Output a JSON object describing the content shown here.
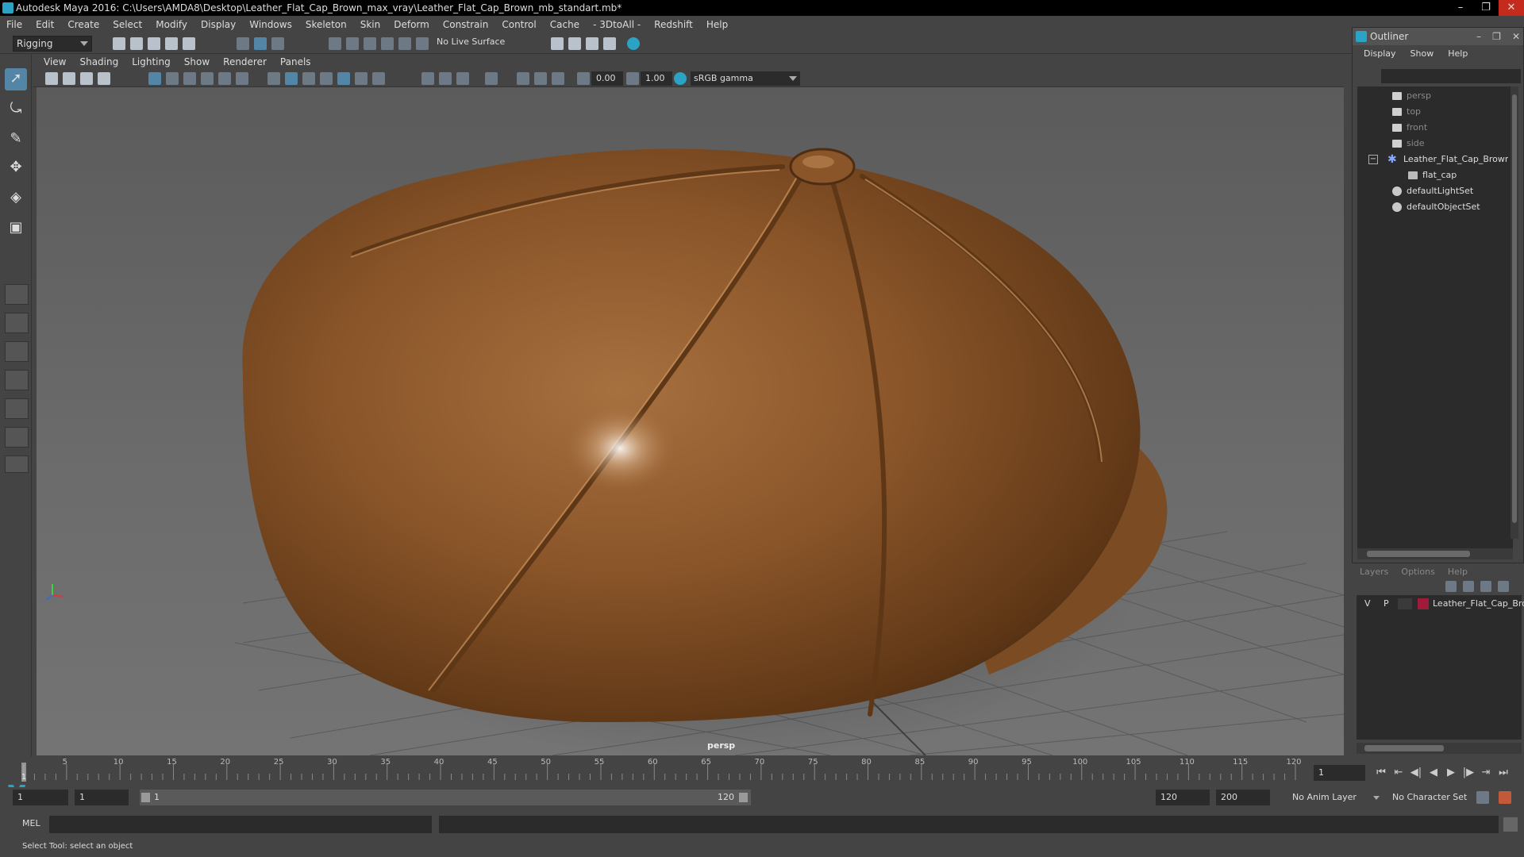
{
  "window": {
    "title": "Autodesk Maya 2016: C:\\Users\\AMDA8\\Desktop\\Leather_Flat_Cap_Brown_max_vray\\Leather_Flat_Cap_Brown_mb_standart.mb*",
    "controls": [
      "–",
      "❐",
      "✕"
    ]
  },
  "menubar": [
    "File",
    "Edit",
    "Create",
    "Select",
    "Modify",
    "Display",
    "Windows",
    "Skeleton",
    "Skin",
    "Deform",
    "Constrain",
    "Control",
    "Cache",
    "- 3DtoAll -",
    "Redshift",
    "Help"
  ],
  "statusline": {
    "mode": "Rigging",
    "live_surface": "No Live Surface"
  },
  "panel": {
    "menus": [
      "View",
      "Shading",
      "Lighting",
      "Show",
      "Renderer",
      "Panels"
    ],
    "exposure": "0.00",
    "gamma_value": "1.00",
    "color_space": "sRGB gamma",
    "camera_label": "persp"
  },
  "outliner": {
    "title": "Outliner",
    "menus": [
      "Display",
      "Show",
      "Help"
    ],
    "items": [
      {
        "label": "persp",
        "kind": "camera",
        "dim": true
      },
      {
        "label": "top",
        "kind": "camera",
        "dim": true
      },
      {
        "label": "front",
        "kind": "camera",
        "dim": true
      },
      {
        "label": "side",
        "kind": "camera",
        "dim": true
      },
      {
        "label": "Leather_Flat_Cap_Brown",
        "kind": "group",
        "dim": false
      },
      {
        "label": "flat_cap",
        "kind": "mesh",
        "dim": false
      },
      {
        "label": "defaultLightSet",
        "kind": "set",
        "dim": false
      },
      {
        "label": "defaultObjectSet",
        "kind": "set",
        "dim": false
      }
    ],
    "expand_glyph": "−"
  },
  "layers": {
    "menus": [
      "Layers",
      "Options",
      "Help"
    ],
    "row": {
      "visible": "V",
      "playback": "P",
      "name": "Leather_Flat_Cap_Brov",
      "color": "#9e1b3a"
    }
  },
  "timeline": {
    "start": 1,
    "end": 120,
    "ticks": [
      "1",
      "5",
      "10",
      "15",
      "20",
      "25",
      "30",
      "35",
      "40",
      "45",
      "50",
      "55",
      "60",
      "65",
      "70",
      "75",
      "80",
      "85",
      "90",
      "95",
      "100",
      "105",
      "110",
      "115",
      "120"
    ],
    "current_frame": "1"
  },
  "range": {
    "start_field": "1",
    "current_field": "1",
    "slider_start": "1",
    "slider_end": "120",
    "end_field": "120",
    "max_field": "200",
    "anim_layer": "No Anim Layer",
    "char_set": "No Character Set"
  },
  "command": {
    "language": "MEL",
    "help": "Select Tool: select an object"
  },
  "colors": {
    "accent": "#5285a6",
    "leather": "#7a4a22",
    "layer": "#9e1b3a"
  }
}
